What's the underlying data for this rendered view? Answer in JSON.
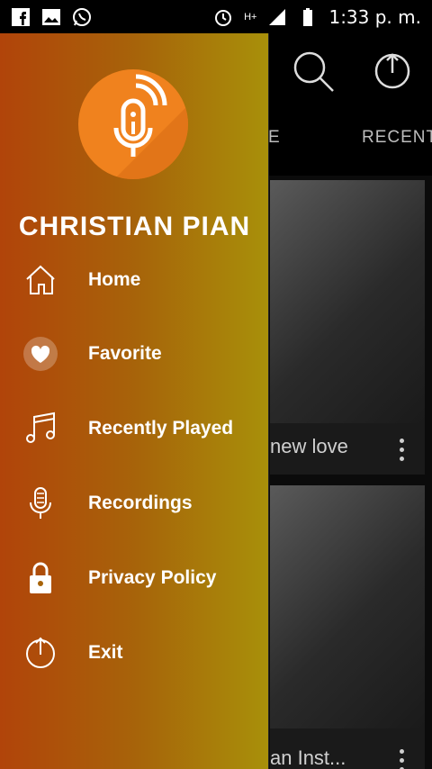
{
  "status_bar": {
    "left_icons": [
      "facebook-icon",
      "gallery-icon",
      "whatsapp-icon"
    ],
    "network": "H+",
    "time": "1:33 p. m."
  },
  "app": {
    "tabs": [
      "E",
      "RECENT"
    ],
    "cards": [
      {
        "title": "new love"
      },
      {
        "title": "an Inst..."
      }
    ]
  },
  "drawer": {
    "app_name": "CHRISTIAN PIAN",
    "menu": [
      {
        "label": "Home",
        "icon": "home-icon"
      },
      {
        "label": "Favorite",
        "icon": "heart-icon"
      },
      {
        "label": "Recently Played",
        "icon": "music-note-icon"
      },
      {
        "label": "Recordings",
        "icon": "microphone-icon"
      },
      {
        "label": "Privacy Policy",
        "icon": "lock-icon"
      },
      {
        "label": "Exit",
        "icon": "power-icon"
      }
    ],
    "colors": {
      "gradient_start": "#b1440a",
      "gradient_end": "#a8900a",
      "logo": "#f0821e"
    }
  }
}
